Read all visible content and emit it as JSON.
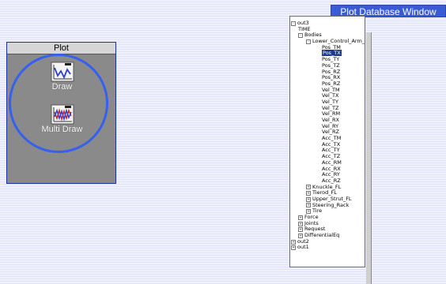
{
  "plot_panel": {
    "title": "Plot",
    "tools": [
      {
        "label": "Draw",
        "icon": "draw-icon"
      },
      {
        "label": "Multi Draw",
        "icon": "multi-draw-icon"
      }
    ]
  },
  "db_window": {
    "title": "Plot Database Window",
    "tree": [
      {
        "label": "out3",
        "level": 0,
        "expander": "-"
      },
      {
        "label": "TIME",
        "level": 1,
        "expander": ""
      },
      {
        "label": "Bodies",
        "level": 1,
        "expander": "-"
      },
      {
        "label": "Lower_Control_Arm_",
        "level": 2,
        "expander": "-"
      },
      {
        "label": "Pos_TM",
        "level": 3,
        "expander": ""
      },
      {
        "label": "Pos_TX",
        "level": 3,
        "expander": "",
        "selected": true
      },
      {
        "label": "Pos_TY",
        "level": 3,
        "expander": ""
      },
      {
        "label": "Pos_TZ",
        "level": 3,
        "expander": ""
      },
      {
        "label": "Pos_RZ",
        "level": 3,
        "expander": ""
      },
      {
        "label": "Pos_RX",
        "level": 3,
        "expander": ""
      },
      {
        "label": "Pos_RZ",
        "level": 3,
        "expander": ""
      },
      {
        "label": "Vel_TM",
        "level": 3,
        "expander": ""
      },
      {
        "label": "Vel_TX",
        "level": 3,
        "expander": ""
      },
      {
        "label": "Vel_TY",
        "level": 3,
        "expander": ""
      },
      {
        "label": "Vel_TZ",
        "level": 3,
        "expander": ""
      },
      {
        "label": "Vel_RM",
        "level": 3,
        "expander": ""
      },
      {
        "label": "Vel_RX",
        "level": 3,
        "expander": ""
      },
      {
        "label": "Vel_RY",
        "level": 3,
        "expander": ""
      },
      {
        "label": "Vel_RZ",
        "level": 3,
        "expander": ""
      },
      {
        "label": "Acc_TM",
        "level": 3,
        "expander": ""
      },
      {
        "label": "Acc_TX",
        "level": 3,
        "expander": ""
      },
      {
        "label": "Acc_TY",
        "level": 3,
        "expander": ""
      },
      {
        "label": "Acc_TZ",
        "level": 3,
        "expander": ""
      },
      {
        "label": "Acc_RM",
        "level": 3,
        "expander": ""
      },
      {
        "label": "Acc_RX",
        "level": 3,
        "expander": ""
      },
      {
        "label": "Acc_RY",
        "level": 3,
        "expander": ""
      },
      {
        "label": "Acc_RZ",
        "level": 3,
        "expander": ""
      },
      {
        "label": "Knuckle_FL",
        "level": 2,
        "expander": "+"
      },
      {
        "label": "Tierod_FL",
        "level": 2,
        "expander": "+"
      },
      {
        "label": "Upper_Strut_FL",
        "level": 2,
        "expander": "+"
      },
      {
        "label": "Steering_Rack",
        "level": 2,
        "expander": "+"
      },
      {
        "label": "Tire",
        "level": 2,
        "expander": "+"
      },
      {
        "label": "Force",
        "level": 1,
        "expander": "+"
      },
      {
        "label": "Joints",
        "level": 1,
        "expander": "+"
      },
      {
        "label": "Request",
        "level": 1,
        "expander": "+"
      },
      {
        "label": "DifferentialEq",
        "level": 1,
        "expander": "+"
      },
      {
        "label": "out2",
        "level": 0,
        "expander": "+"
      },
      {
        "label": "out1",
        "level": 0,
        "expander": "+"
      }
    ]
  },
  "colors": {
    "accent": "#3a5bd6",
    "selection": "#1b3a8f",
    "circle": "#3560f0"
  }
}
